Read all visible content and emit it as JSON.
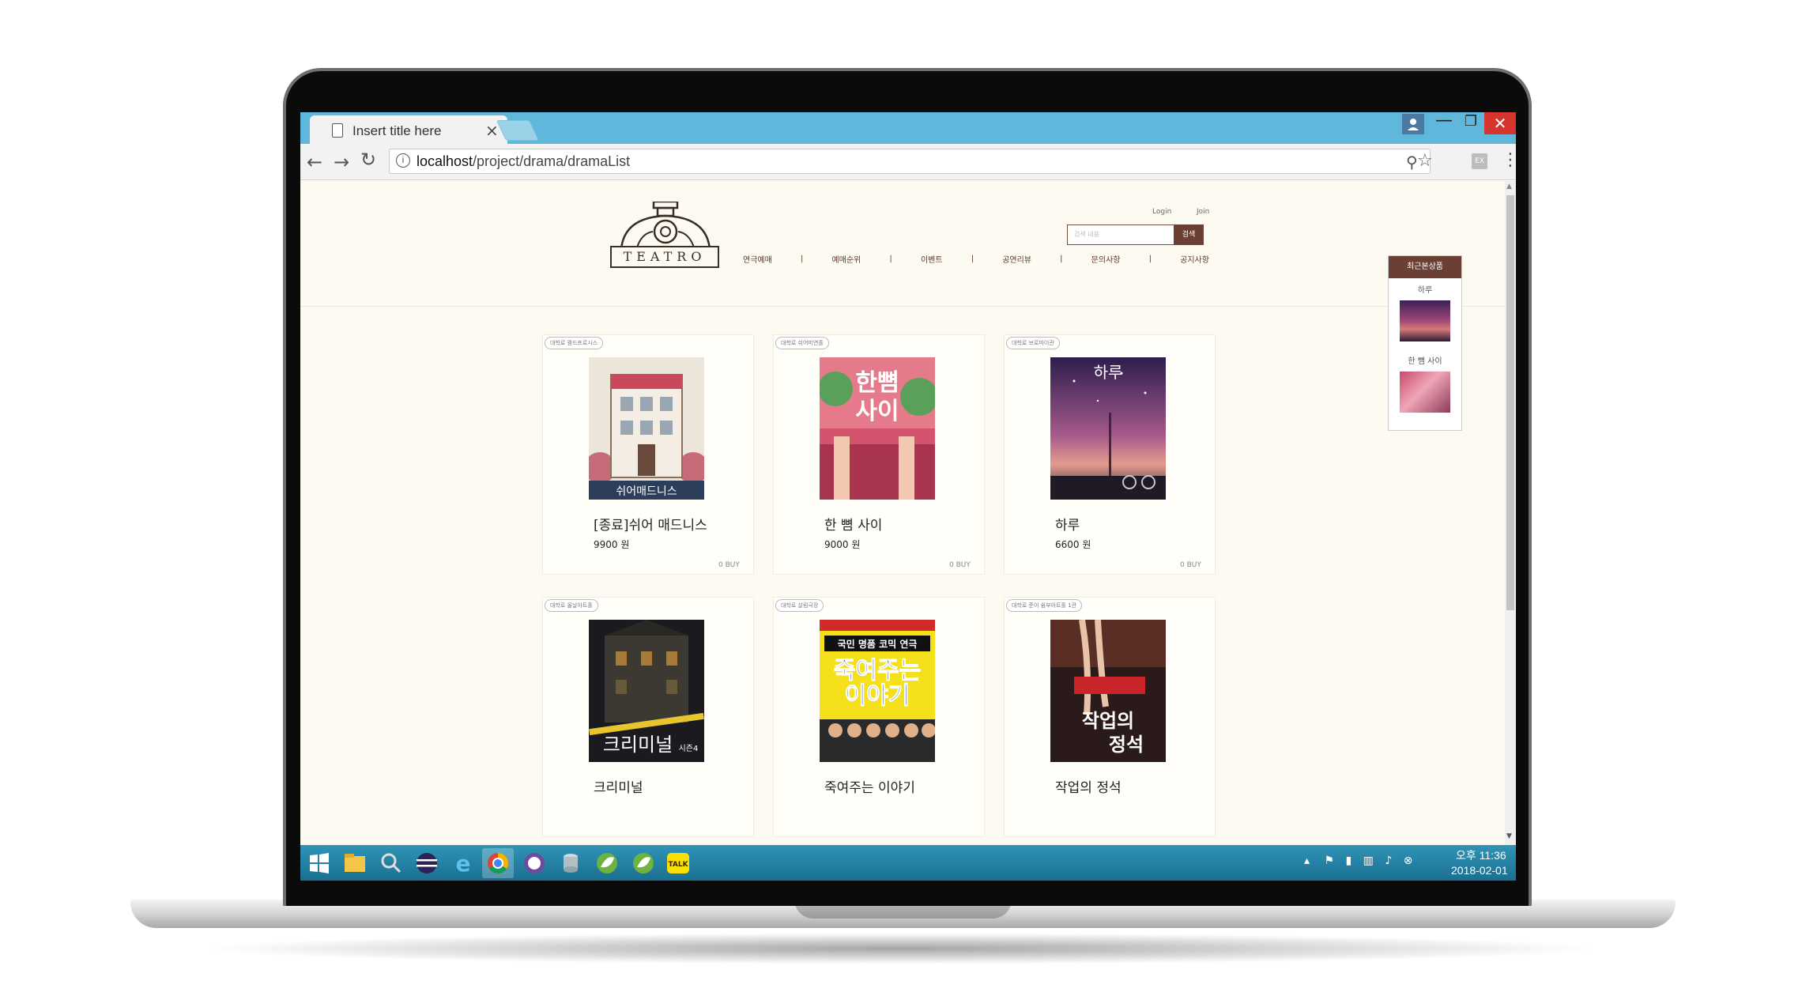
{
  "browser": {
    "tab_title": "Insert title here",
    "tab_close": "×",
    "url_host": "localhost",
    "url_path": "/project/drama/dramaList"
  },
  "site": {
    "logo_text": "TEATRO",
    "login": "Login",
    "join": "Join",
    "search_placeholder": "검색 내용",
    "search_button": "검색",
    "nav": [
      "연극예매",
      "예매순위",
      "이벤트",
      "공연리뷰",
      "문의사항",
      "공지사항"
    ]
  },
  "recent": {
    "title": "최근본상품",
    "items": [
      "하루",
      "한 뼘 사이"
    ]
  },
  "products": [
    {
      "tag": "대학로 웬드프로시스",
      "title": "[종료]쉬어 매드니스",
      "price": "9900 원",
      "buy": "0 BUY"
    },
    {
      "tag": "대학로 쉬어미연홀",
      "title": "한 뼘 사이",
      "price": "9000 원",
      "buy": "0 BUY"
    },
    {
      "tag": "대학로 브로마이관",
      "title": "하루",
      "price": "6600 원",
      "buy": "0 BUY"
    },
    {
      "tag": "대학로 올날아트홀",
      "title": "크리미널",
      "price": "",
      "buy": ""
    },
    {
      "tag": "대학로 살림극장",
      "title": "죽여주는 이야기",
      "price": "",
      "buy": ""
    },
    {
      "tag": "대학로 준이 쉼부아트홀 1관",
      "title": "작업의 정석",
      "price": "",
      "buy": ""
    }
  ],
  "posters": {
    "poster_1": "쉬어매드니스",
    "poster_2_a": "한뼘",
    "poster_2_b": "사이",
    "poster_3": "하루",
    "poster_4": "크리미널",
    "poster_4_sub": "시즌4",
    "poster_5_top": "국민 명품 코믹 연극",
    "poster_5_a": "죽여주는",
    "poster_5_b": "이야기",
    "poster_6_a": "작업의",
    "poster_6_b": "정석"
  },
  "taskbar": {
    "clock_time": "오후 11:36",
    "clock_date": "2018-02-01"
  }
}
